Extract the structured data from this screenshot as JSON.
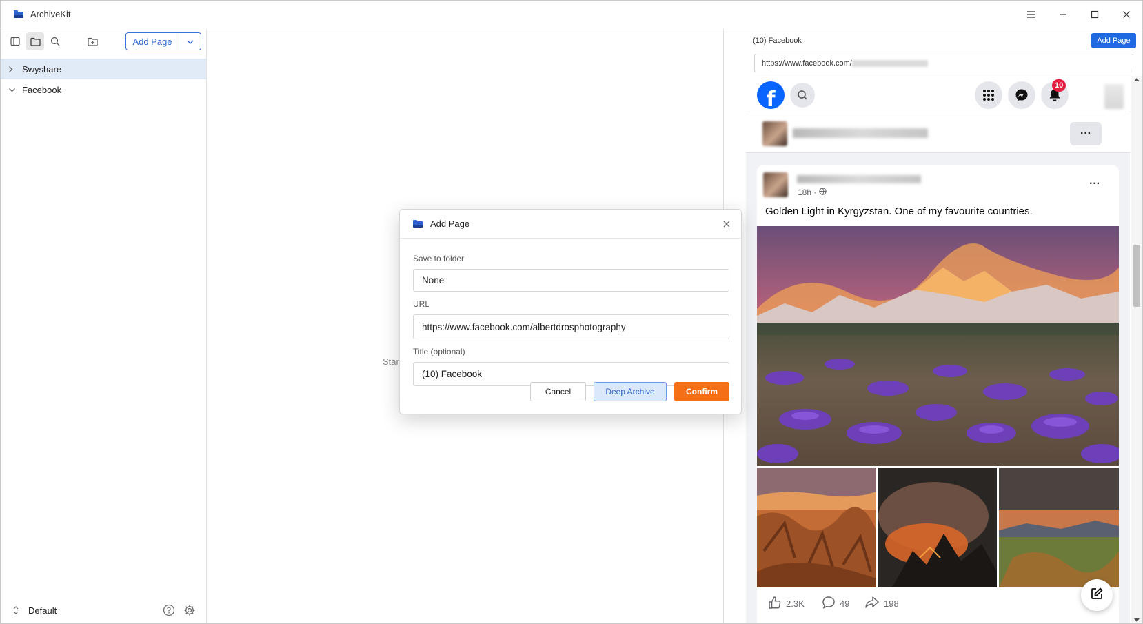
{
  "app": {
    "title": "ArchiveKit"
  },
  "sidebar": {
    "add_page_label": "Add Page",
    "tree": [
      {
        "label": "Swyshare",
        "expanded": false,
        "selected": true
      },
      {
        "label": "Facebook",
        "expanded": true,
        "selected": false
      }
    ],
    "footer": {
      "workspace": "Default"
    }
  },
  "main": {
    "hint_text": "Star"
  },
  "browser": {
    "tab_title": "(10) Facebook",
    "add_page_label": "Add Page",
    "url_visible": "https://www.facebook.com/",
    "facebook": {
      "logo_letter": "f",
      "notification_count": "10",
      "post": {
        "time": "18h ·",
        "text": "Golden Light in Kyrgyzstan. One of my favourite countries.",
        "likes": "2.3K",
        "comments": "49",
        "shares": "198"
      }
    }
  },
  "dialog": {
    "title": "Add Page",
    "folder_label": "Save to folder",
    "folder_value": "None",
    "url_label": "URL",
    "url_value": "https://www.facebook.com/albertdrosphotography",
    "title_label": "Title (optional)",
    "title_value": "(10) Facebook",
    "cancel_label": "Cancel",
    "deep_archive_label": "Deep Archive",
    "confirm_label": "Confirm"
  },
  "colors": {
    "accent_blue": "#2d66d1",
    "confirm_orange": "#f56f16",
    "facebook_blue": "#0866ff",
    "notification_red": "#e41e3f"
  },
  "icons": [
    "archivekit-logo-icon",
    "menu-icon",
    "minimize-icon",
    "maximize-icon",
    "close-icon",
    "sidebar-toggle-icon",
    "folder-icon",
    "search-icon",
    "new-folder-icon",
    "chevron-down-icon",
    "chevron-right-icon",
    "updown-icon",
    "help-icon",
    "gear-icon",
    "grid-menu-icon",
    "messenger-icon",
    "bell-icon",
    "globe-icon",
    "like-icon",
    "comment-icon",
    "share-icon",
    "edit-icon"
  ]
}
